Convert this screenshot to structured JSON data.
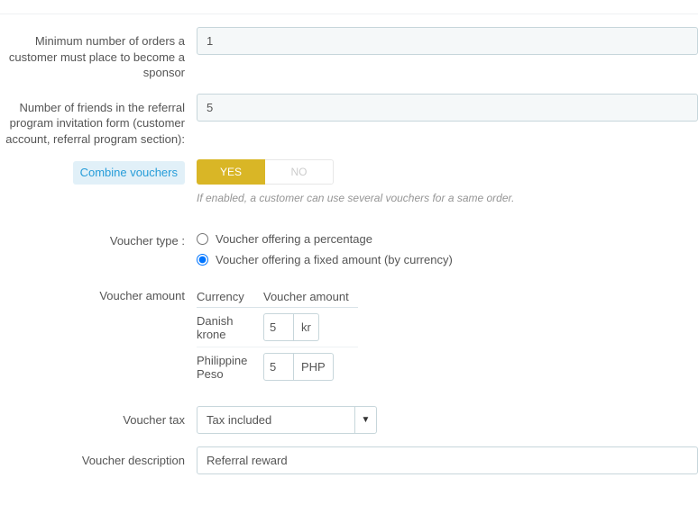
{
  "fields": {
    "min_orders": {
      "label": "Minimum number of orders a customer must place to become a sponsor",
      "value": "1"
    },
    "num_friends": {
      "label": "Number of friends in the referral program invitation form (customer account, referral program section):",
      "value": "5"
    },
    "combine": {
      "label": "Combine vouchers",
      "yes": "YES",
      "no": "NO",
      "help": "If enabled, a customer can use several vouchers for a same order."
    },
    "voucher_type": {
      "label": "Voucher type :",
      "opt_percentage": "Voucher offering a percentage",
      "opt_fixed": "Voucher offering a fixed amount (by currency)"
    },
    "voucher_amount": {
      "label": "Voucher amount",
      "col_currency": "Currency",
      "col_amount": "Voucher amount",
      "rows": [
        {
          "currency": "Danish krone",
          "value": "5",
          "unit": "kr"
        },
        {
          "currency": "Philippine Peso",
          "value": "5",
          "unit": "PHP"
        }
      ]
    },
    "voucher_tax": {
      "label": "Voucher tax",
      "selected": "Tax included"
    },
    "voucher_desc": {
      "label": "Voucher description",
      "value": "Referral reward"
    }
  }
}
